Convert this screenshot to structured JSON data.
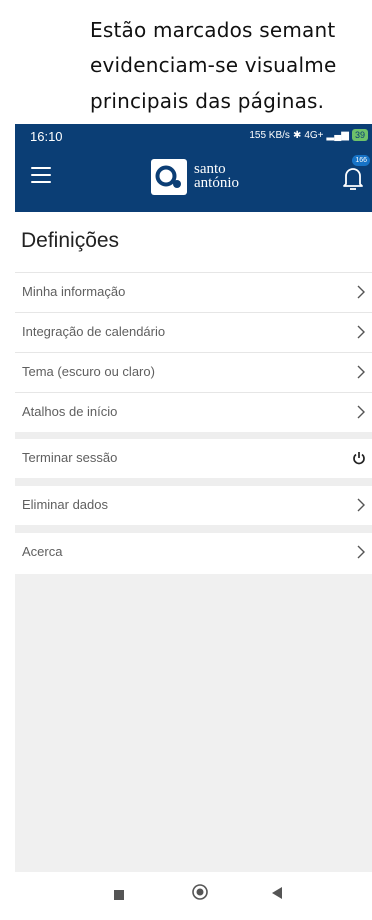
{
  "document": {
    "top_fragment": "",
    "lines": [
      "Estão marcados semant",
      "evidenciam-se visualme",
      "principais das páginas."
    ]
  },
  "status_bar": {
    "time": "16:10",
    "speed": "155 KB/s",
    "network": "4G+",
    "battery": "39"
  },
  "app_bar": {
    "brand_line1": "santo",
    "brand_line2": "antónio",
    "notification_count": "166"
  },
  "page": {
    "title": "Definições"
  },
  "settings": {
    "group1": [
      {
        "label": "Minha informação"
      },
      {
        "label": "Integração de calendário"
      },
      {
        "label": "Tema (escuro ou claro)"
      },
      {
        "label": "Atalhos de início"
      }
    ],
    "logout_label": "Terminar sessão",
    "delete_label": "Eliminar dados",
    "about_label": "Acerca"
  },
  "colors": {
    "primary": "#0b3e75",
    "background": "#f0f0f0",
    "text": "#5f5f5f"
  }
}
